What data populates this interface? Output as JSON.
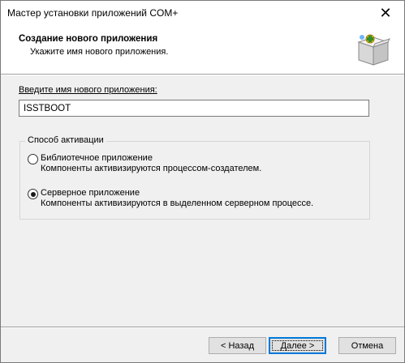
{
  "window": {
    "title": "Мастер установки приложений COM+"
  },
  "header": {
    "title": "Создание нового приложения",
    "subtitle": "Укажите имя нового приложения."
  },
  "name_field": {
    "label": "Введите имя нового приложения:",
    "value": "ISSTBOOT"
  },
  "activation": {
    "legend": "Способ активации",
    "options": [
      {
        "label": "Библиотечное приложение",
        "description": "Компоненты активизируются процессом-создателем.",
        "checked": false
      },
      {
        "label": "Серверное приложение",
        "description": "Компоненты активизируются в выделенном серверном процессе.",
        "checked": true
      }
    ]
  },
  "buttons": {
    "back": "< Назад",
    "next": "Далее >",
    "cancel": "Отмена"
  },
  "icons": {
    "close": "close-icon",
    "wizard": "com-package-icon"
  }
}
